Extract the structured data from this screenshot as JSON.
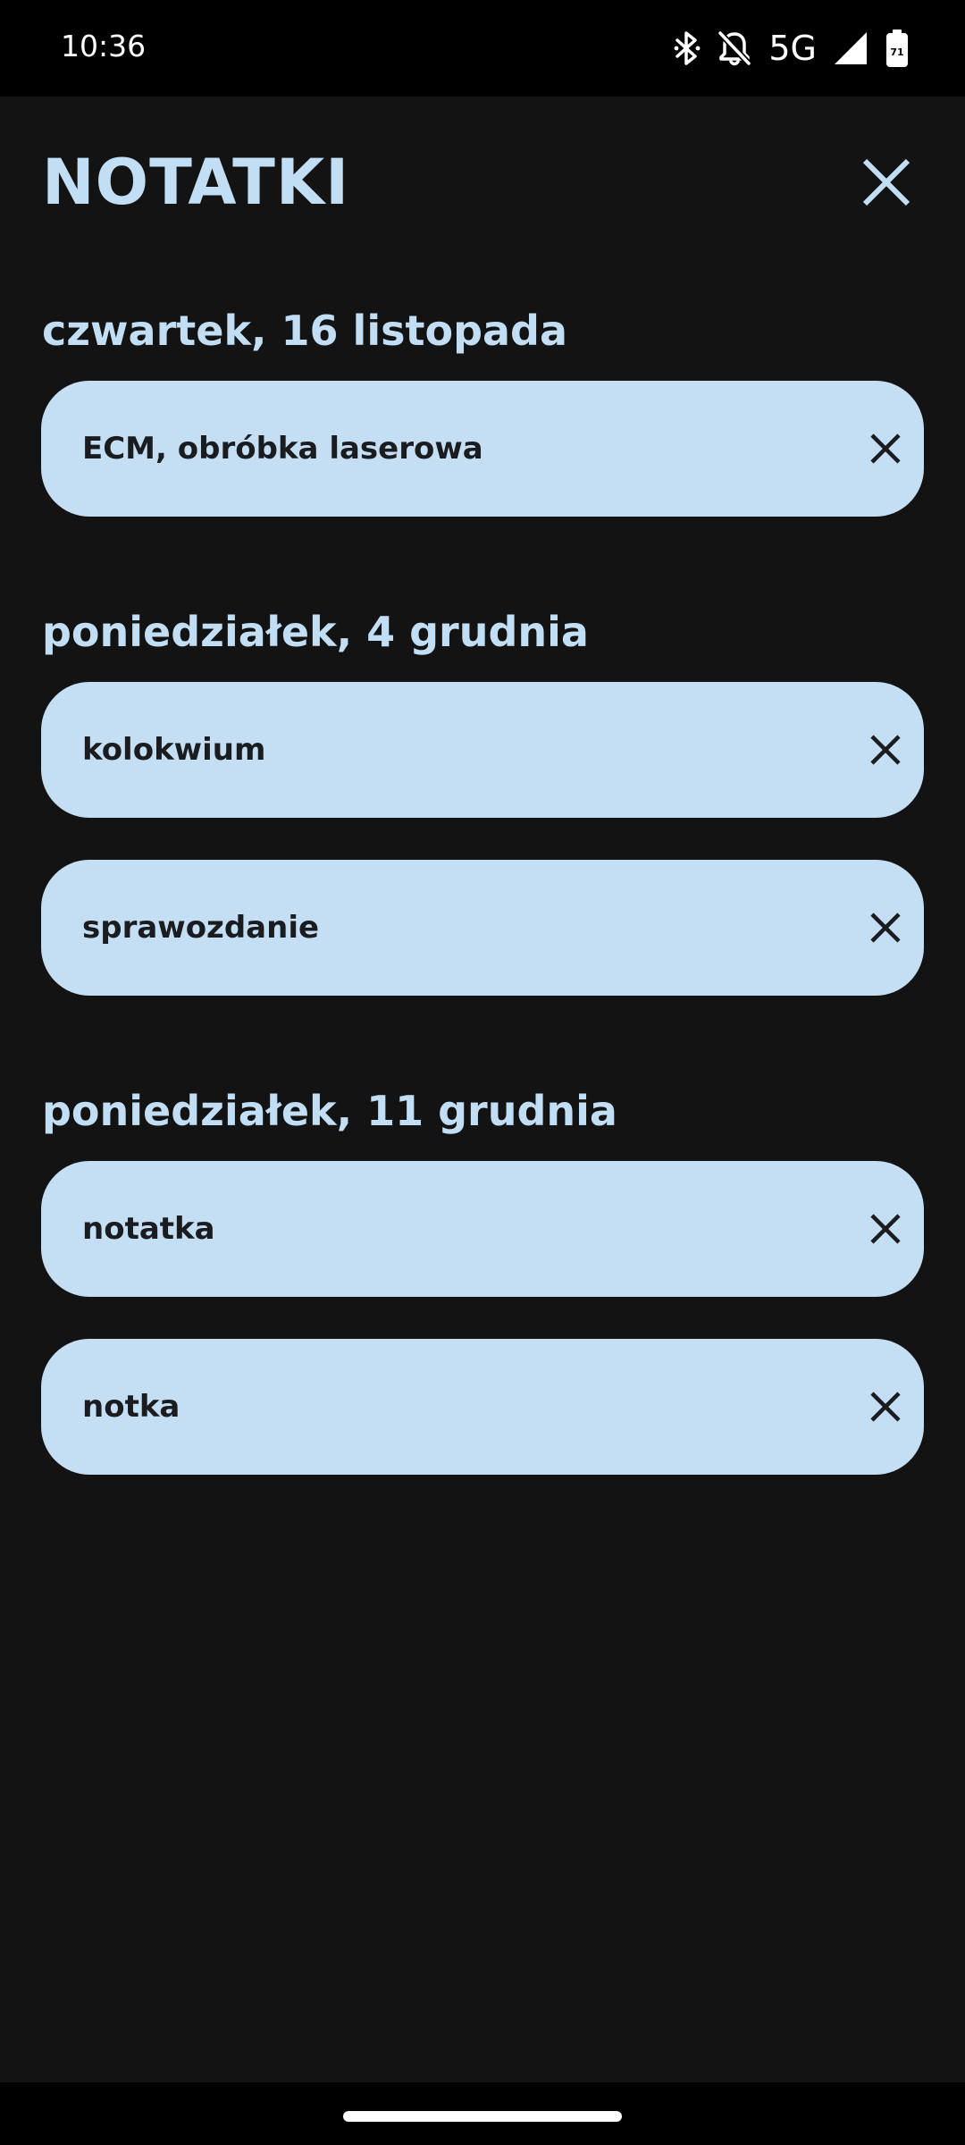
{
  "status_bar": {
    "time": "10:36",
    "network": "5G",
    "battery_level": "71",
    "icons": [
      "bluetooth-icon",
      "notifications-off-icon",
      "signal-icon",
      "battery-icon"
    ]
  },
  "header": {
    "title": "NOTATKI",
    "close_icon": "close-icon"
  },
  "groups": [
    {
      "date": "czwartek, 16 listopada",
      "notes": [
        "ECM, obróbka laserowa"
      ]
    },
    {
      "date": "poniedziałek, 4 grudnia",
      "notes": [
        "kolokwium",
        "sprawozdanie"
      ]
    },
    {
      "date": "poniedziałek, 11 grudnia",
      "notes": [
        "notatka",
        "notka"
      ]
    }
  ],
  "colors": {
    "background": "#131313",
    "accent": "#c2def4",
    "card": "#c4dff4",
    "card_text": "#1a1c1f"
  }
}
